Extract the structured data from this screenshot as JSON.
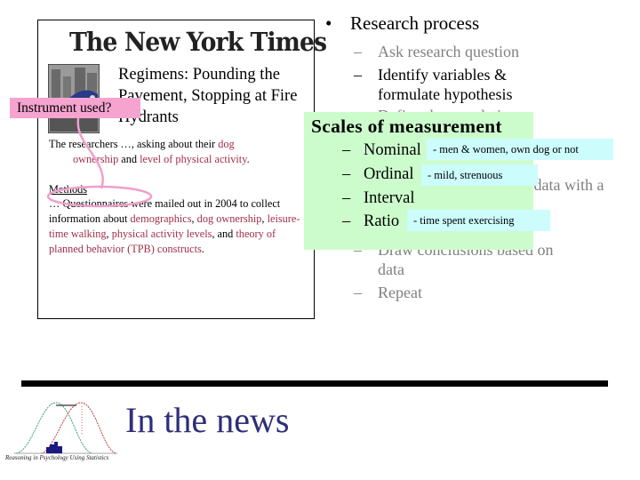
{
  "article": {
    "masthead": "The New York Times",
    "thumbnail_icon": "runner-with-dog-cartoon-icon",
    "headline": "Regimens: Pounding the Pavement, Stopping at Fire Hydrants",
    "para1": {
      "t1": "The researchers …, asking about their ",
      "h1": "dog",
      "h2": "ownership",
      "t2": " and ",
      "h3": "level of physical activity",
      "t3": "."
    },
    "methods_heading": "Methods",
    "para2": {
      "t1": "… Questionnaires were mailed out in 2004 to collect information about ",
      "h1": "demographics",
      "t2": ", ",
      "h2": "dog ownership",
      "t3": ", ",
      "h3": "leisure-time walking",
      "t4": ", ",
      "h4": "physical activity levels",
      "t5": ", and ",
      "h5": "theory of planned behavior (TPB) constructs",
      "t6": "."
    }
  },
  "callout": {
    "label": "Instrument used?",
    "color": "#f5a3cf"
  },
  "research_process": {
    "bullet": "•",
    "title": "Research process",
    "dash": "–",
    "steps": [
      {
        "line1": "Ask research question",
        "state": "dimmed"
      },
      {
        "line1": "Identify variables &",
        "line2": "formulate hypothesis",
        "state": "active"
      },
      {
        "line1": "Define the population",
        "state": "dimmed"
      },
      {
        "line1": "Collect data with a",
        "state": "dimmed"
      },
      {
        "line1": "Draw conclusions based on",
        "line2": "data",
        "state": "dimmed"
      },
      {
        "line1": "Repeat",
        "state": "dimmed"
      }
    ]
  },
  "scales_box": {
    "title": "Scales of measurement",
    "bg_color": "#ccfccc",
    "items": [
      {
        "label": "Nominal",
        "note": "- men & women, own dog or not"
      },
      {
        "label": "Ordinal",
        "note": "-  mild, strenuous"
      },
      {
        "label": "Interval",
        "note": ""
      },
      {
        "label": "Ratio",
        "note": "- time spent exercising"
      }
    ],
    "note_color": "#ccfcfc"
  },
  "footer": {
    "logo_icon": "overlapping-distributions-logo-icon",
    "logo_caption": "Reasoning in Psychology Using Statistics",
    "title": "In the news"
  }
}
